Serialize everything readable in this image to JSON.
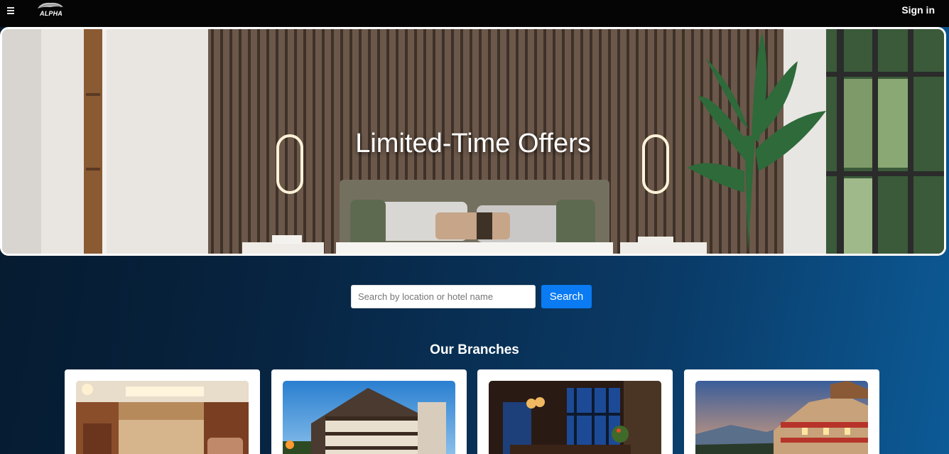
{
  "header": {
    "logo_text": "ALPHA",
    "signin_label": "Sign in"
  },
  "hero": {
    "title": "Limited-Time Offers"
  },
  "search": {
    "placeholder": "Search by location or hotel name",
    "button_label": "Search"
  },
  "branches": {
    "title": "Our Branches",
    "cards": [
      {
        "image": "hotel-lobby-image"
      },
      {
        "image": "hotel-building-image"
      },
      {
        "image": "hotel-restaurant-image"
      },
      {
        "image": "mountain-resort-image"
      }
    ]
  }
}
